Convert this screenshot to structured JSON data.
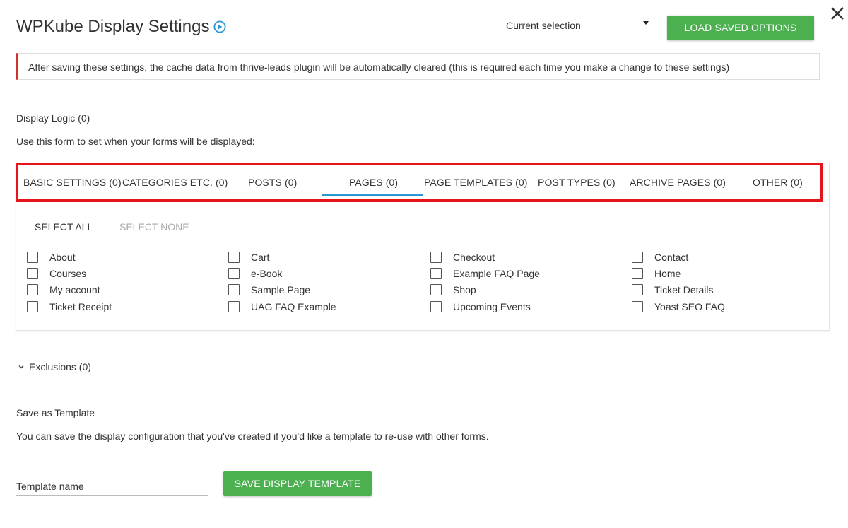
{
  "header": {
    "title": "WPKube Display Settings",
    "selection_value": "Current selection",
    "load_button": "LOAD SAVED OPTIONS"
  },
  "notice": {
    "text": "After saving these settings, the cache data from thrive-leads plugin will be automatically cleared (this is required each time you make a change to these settings)"
  },
  "display_logic": {
    "heading": "Display Logic (0)",
    "description": "Use this form to set when your forms will be displayed:"
  },
  "tabs": [
    {
      "label": "BASIC SETTINGS (0)"
    },
    {
      "label": "CATEGORIES ETC. (0)"
    },
    {
      "label": "POSTS (0)"
    },
    {
      "label": "PAGES (0)",
      "active": true
    },
    {
      "label": "PAGE TEMPLATES (0)"
    },
    {
      "label": "POST TYPES (0)"
    },
    {
      "label": "ARCHIVE PAGES (0)"
    },
    {
      "label": "OTHER (0)"
    }
  ],
  "selection_actions": {
    "select_all": "SELECT ALL",
    "select_none": "SELECT NONE"
  },
  "pages": [
    {
      "label": "About",
      "checked": false
    },
    {
      "label": "Courses",
      "checked": false
    },
    {
      "label": "My account",
      "checked": false
    },
    {
      "label": "Ticket Receipt",
      "checked": false
    },
    {
      "label": "Cart",
      "checked": false
    },
    {
      "label": "e-Book",
      "checked": false
    },
    {
      "label": "Sample Page",
      "checked": false
    },
    {
      "label": "UAG FAQ Example",
      "checked": false
    },
    {
      "label": "Checkout",
      "checked": false
    },
    {
      "label": "Example FAQ Page",
      "checked": false
    },
    {
      "label": "Shop",
      "checked": false
    },
    {
      "label": "Upcoming Events",
      "checked": false
    },
    {
      "label": "Contact",
      "checked": false
    },
    {
      "label": "Home",
      "checked": false
    },
    {
      "label": "Ticket Details",
      "checked": false
    },
    {
      "label": "Yoast SEO FAQ",
      "checked": false
    }
  ],
  "exclusions": {
    "label": "Exclusions (0)"
  },
  "template": {
    "heading": "Save as Template",
    "description": "You can save the display configuration that you've created if you'd like a template to re-use with other forms.",
    "name_placeholder": "Template name",
    "save_button": "SAVE DISPLAY TEMPLATE"
  },
  "colors": {
    "accent_green": "#4caf50",
    "tab_underline_blue": "#2a96d4",
    "notice_border_red": "#d0312d",
    "highlight_frame_red": "#e8141c"
  }
}
